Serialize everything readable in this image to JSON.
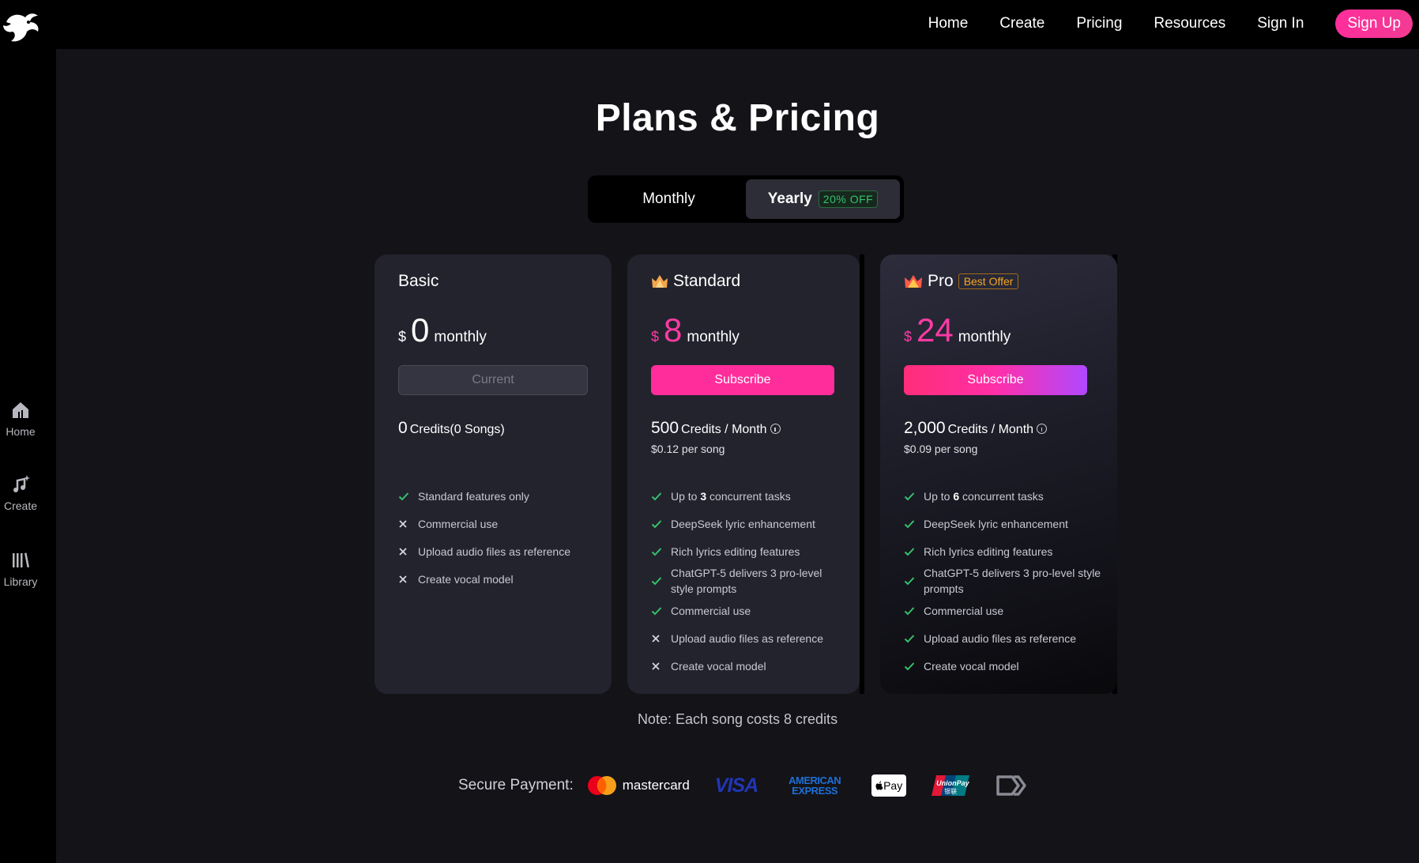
{
  "nav": {
    "links": [
      "Home",
      "Create",
      "Pricing",
      "Resources",
      "Sign In"
    ],
    "signup": "Sign Up"
  },
  "sidebar": {
    "items": [
      {
        "label": "Home",
        "icon": "home-icon"
      },
      {
        "label": "Create",
        "icon": "music-note-icon"
      },
      {
        "label": "Library",
        "icon": "library-icon"
      }
    ]
  },
  "page": {
    "title": "Plans & Pricing",
    "note": "Note: Each song costs 8 credits"
  },
  "billing": {
    "monthly": "Monthly",
    "yearly": "Yearly",
    "yearly_badge": "20% OFF",
    "selected": "Yearly"
  },
  "plans": [
    {
      "name": "Basic",
      "currency": "$",
      "amount": "0",
      "period": "monthly",
      "button": "Current",
      "credits": "0",
      "credits_label": "Credits(0 Songs)",
      "features": [
        {
          "text": "Standard features only",
          "included": true
        },
        {
          "text": "Commercial use",
          "included": false
        },
        {
          "text": "Upload audio files as reference",
          "included": false
        },
        {
          "text": "Create vocal model",
          "included": false
        }
      ]
    },
    {
      "name": "Standard",
      "currency": "$",
      "amount": "8",
      "period": "monthly",
      "button": "Subscribe",
      "credits": "500",
      "credits_label": "Credits / Month",
      "per_song": "$0.12 per song",
      "features": [
        {
          "pre": "Up to ",
          "bold": "3",
          "post": " concurrent tasks",
          "included": true
        },
        {
          "text": "DeepSeek lyric enhancement",
          "included": true
        },
        {
          "text": "Rich lyrics editing features",
          "included": true
        },
        {
          "text": "ChatGPT-5 delivers 3 pro-level style prompts",
          "included": true
        },
        {
          "text": "Commercial use",
          "included": true
        },
        {
          "text": "Upload audio files as reference",
          "included": false
        },
        {
          "text": "Create vocal model",
          "included": false
        }
      ]
    },
    {
      "name": "Pro",
      "badge": "Best Offer",
      "currency": "$",
      "amount": "24",
      "period": "monthly",
      "button": "Subscribe",
      "credits": "2,000",
      "credits_label": "Credits / Month",
      "per_song": "$0.09 per song",
      "features": [
        {
          "pre": "Up to ",
          "bold": "6",
          "post": " concurrent tasks",
          "included": true
        },
        {
          "text": "DeepSeek lyric enhancement",
          "included": true
        },
        {
          "text": "Rich lyrics editing features",
          "included": true
        },
        {
          "text": "ChatGPT-5 delivers 3 pro-level style prompts",
          "included": true
        },
        {
          "text": "Commercial use",
          "included": true
        },
        {
          "text": "Upload audio files as reference",
          "included": true
        },
        {
          "text": "Create vocal model",
          "included": true
        }
      ]
    }
  ],
  "payment": {
    "label": "Secure Payment:",
    "methods": [
      "mastercard",
      "VISA",
      "AMERICAN EXPRESS",
      "Pay",
      "UnionPay",
      "银联"
    ]
  },
  "colors": {
    "accent_pink": "#ff2d9b",
    "check_green": "#36c26b",
    "badge_orange": "#f5a623"
  }
}
